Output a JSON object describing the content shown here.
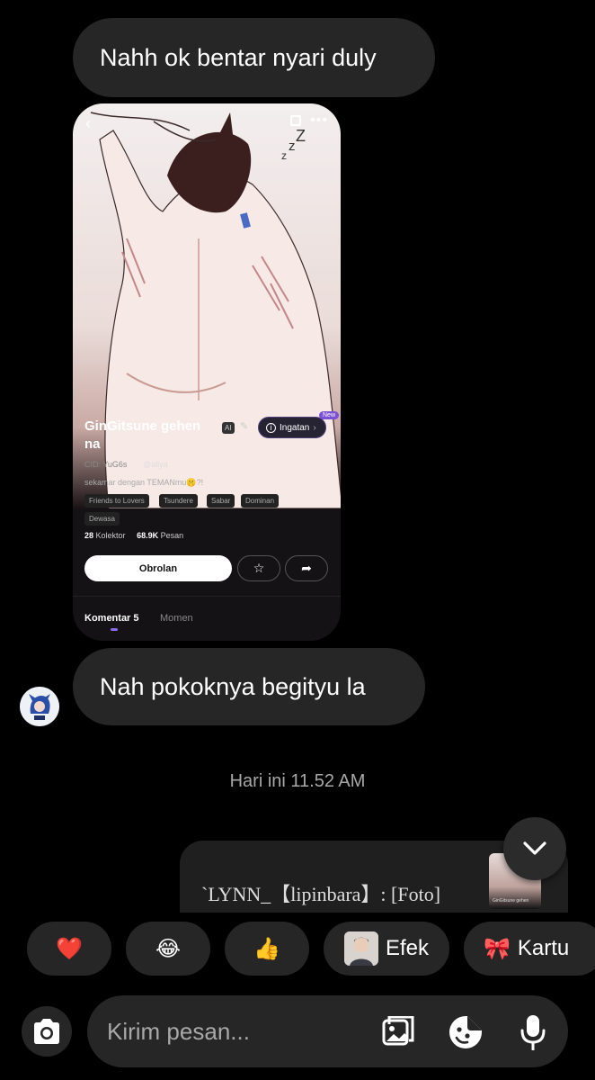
{
  "messages": [
    {
      "text": "Nahh ok bentar nyari duly"
    },
    {
      "text": "Nah pokoknya begityu la"
    }
  ],
  "shared_screenshot": {
    "character_name": "GinGitsune gehen na",
    "ai_tag": "AI",
    "memory_button": "Ingatan",
    "new_badge": "New",
    "cid": "CID: YuG6s",
    "handle": "@aliya",
    "description": "sekamar dengan TEMANmu🤫?!",
    "tags": [
      "Friends to Lovers",
      "Tsundere",
      "Sabar",
      "Dominan",
      "Dewasa"
    ],
    "collectors_count": "28",
    "collectors_label": "Kolektor",
    "messages_count": "68.9K",
    "messages_label": "Pesan",
    "chat_button": "Obrolan",
    "tab_comments": "Komentar 5",
    "tab_moments": "Momen"
  },
  "timestamp": "Hari ini 11.52 AM",
  "reply_preview": {
    "text": "`LYNN_【lipinbara】: [Foto]",
    "thumb_caption": "GinGitsune gehen"
  },
  "quick_reactions": [
    {
      "emoji": "❤️",
      "name": "heart"
    },
    {
      "emoji": "😂",
      "name": "laughing"
    },
    {
      "emoji": "👍",
      "name": "thumbs-up"
    }
  ],
  "effect_chip": {
    "label": "Efek"
  },
  "card_chip": {
    "label": "Kartu",
    "emoji": "🎀"
  },
  "composer": {
    "placeholder": "Kirim pesan..."
  },
  "colors": {
    "bubble": "#262626",
    "background": "#000000",
    "accent": "#8a6cf0"
  }
}
